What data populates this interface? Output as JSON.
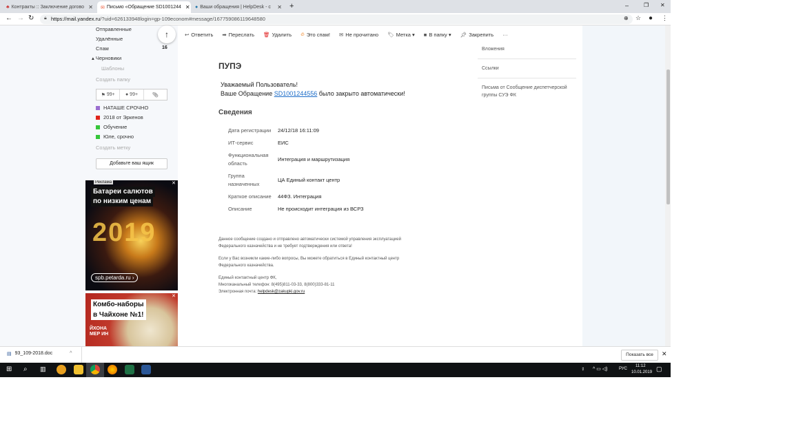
{
  "browser": {
    "tabs": [
      {
        "title": "Контракты :: Заключение догово"
      },
      {
        "title": "Письмо «Обращение SD1001244"
      },
      {
        "title": "Ваши обращения | HelpDesk - с"
      }
    ],
    "url_host": "https://mail.yandex.ru",
    "url_rest": "/?uid=626133948login=gp-109econom#message/167759086119648580"
  },
  "sidebar": {
    "folders": [
      {
        "label": "Отправленные"
      },
      {
        "label": "Удалённые"
      },
      {
        "label": "Спам",
        "count": "16"
      },
      {
        "label": "▴ Черновики"
      },
      {
        "label": "Шаблоны"
      }
    ],
    "create_folder": "Создать папку",
    "filters": {
      "flagged": "99+",
      "unread": "99+"
    },
    "labels": [
      {
        "label": "НАТАШЕ СРОЧНО",
        "color": "#9b6fd0"
      },
      {
        "label": "2018 от Эркенов",
        "color": "#e0251b"
      },
      {
        "label": "Обучение",
        "color": "#36c63a"
      },
      {
        "label": "Юле, срочно",
        "color": "#36c63a"
      }
    ],
    "create_label": "Создать метку",
    "add_mailbox": "Добавьте ваш ящик"
  },
  "ads": [
    {
      "tag": "Реклама",
      "line1": "Батареи салютов",
      "line2": "по низким ценам",
      "link": "spb.petarda.ru ›",
      "art": "2019"
    },
    {
      "line1": "Комбо-наборы",
      "line2": "в Чайхоне №1!",
      "art": "ЙХОНА МЕР ИН"
    }
  ],
  "toolbar": {
    "reply": "Ответить",
    "forward": "Переслать",
    "delete": "Удалить",
    "spam": "Это спам!",
    "unread": "Не прочитано",
    "label": "Метка ▾",
    "folder": "В папку ▾",
    "pin": "Закрепить",
    "more": "···"
  },
  "right_panel": {
    "items": [
      "Вложения",
      "Ссылки",
      "Письма от Сообщение диспетчерской группы СУЭ ФК"
    ]
  },
  "message": {
    "title": "ПУПЭ",
    "greeting": "Уважаемый Пользователь!",
    "line_pre": "Ваше Обращение ",
    "ticket": "SD1001244556",
    "line_post": " было закрыто автоматически!",
    "section": "Сведения",
    "details": [
      {
        "k": "Дата регистрации",
        "v": "24/12/18 16:11:09"
      },
      {
        "k": "ИТ-сервис",
        "v": "ЕИС"
      },
      {
        "k": "Функциональная область",
        "v": "Интеграция и маршрутизация"
      },
      {
        "k": "Группа назначенных",
        "v": "ЦА Единый контакт центр"
      },
      {
        "k": "Краткое описание",
        "v": "44ФЗ. Интеграция"
      },
      {
        "k": "Описание",
        "v": "Не происходит интеграция из ВСРЗ"
      }
    ],
    "footer1": "Данное сообщение создано и отправлено автоматически системой управления эксплуатацией Федерального казначейства и не требует подтверждения или ответа!",
    "footer2": "Если у Вас возникли какие-либо вопросы, Вы можете обратиться в Единый контактный центр Федерального казначейства.",
    "footer3": "Единый контактный центр ФК,",
    "footer4": "Многоканальный телефон: 8(495)811-03-33, 8(800)333-81-11",
    "footer5_label": "Электронная почта: ",
    "email": "helpdesk@zakupki.gov.ru"
  },
  "download": {
    "file": "93_109-2018.doc",
    "show_all": "Показать все"
  },
  "taskbar": {
    "lang": "РУС",
    "time": "11:12",
    "date": "10.01.2019"
  }
}
